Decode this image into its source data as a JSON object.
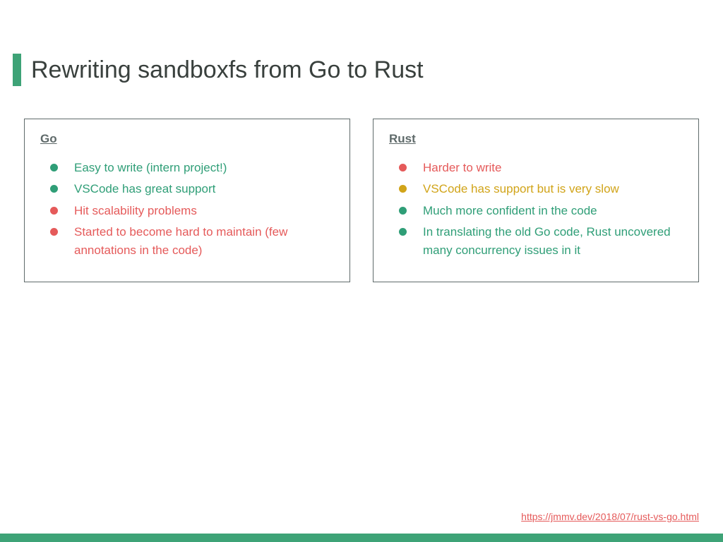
{
  "title": "Rewriting sandboxfs from Go to Rust",
  "columns": {
    "go": {
      "heading": "Go",
      "items": [
        {
          "text": "Easy to write (intern project!)",
          "color": "green"
        },
        {
          "text": "VSCode has great support",
          "color": "green"
        },
        {
          "text": "Hit scalability problems",
          "color": "red"
        },
        {
          "text": "Started to become hard to maintain (few annotations in the code)",
          "color": "red"
        }
      ]
    },
    "rust": {
      "heading": "Rust",
      "items": [
        {
          "text": "Harder to write",
          "color": "red"
        },
        {
          "text": "VSCode has support but is very slow",
          "color": "yellow"
        },
        {
          "text": "Much more confident in the code",
          "color": "green"
        },
        {
          "text": "In translating the old Go code, Rust uncovered many concurrency issues in it",
          "color": "green"
        }
      ]
    }
  },
  "footer_link": "https://jmmv.dev/2018/07/rust-vs-go.html",
  "colors": {
    "accent": "#3ea377",
    "green": "#2f9e77",
    "red": "#e55a5a",
    "yellow": "#d1a419",
    "border": "#5f6a6a"
  }
}
